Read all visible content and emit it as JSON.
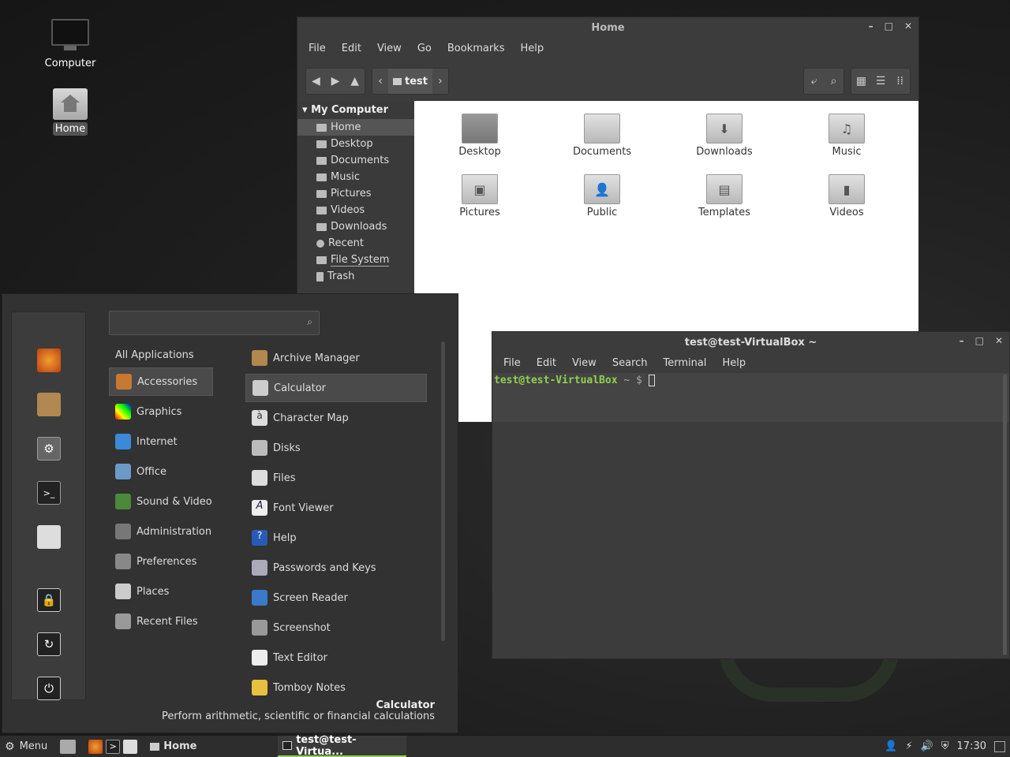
{
  "desktop": {
    "icons": [
      {
        "label": "Computer"
      },
      {
        "label": "Home"
      }
    ]
  },
  "file_manager": {
    "title": "Home",
    "menu": [
      "File",
      "Edit",
      "View",
      "Go",
      "Bookmarks",
      "Help"
    ],
    "path": "test",
    "sidebar_header": "My Computer",
    "sidebar_items": [
      "Home",
      "Desktop",
      "Documents",
      "Music",
      "Pictures",
      "Videos",
      "Downloads",
      "Recent",
      "File System",
      "Trash"
    ],
    "folders": [
      "Desktop",
      "Documents",
      "Downloads",
      "Music",
      "Pictures",
      "Public",
      "Templates",
      "Videos"
    ]
  },
  "start_menu": {
    "search_placeholder": "",
    "categories": [
      "All Applications",
      "Accessories",
      "Graphics",
      "Internet",
      "Office",
      "Sound & Video",
      "Administration",
      "Preferences",
      "Places",
      "Recent Files"
    ],
    "selected_category": "Accessories",
    "apps": [
      "Archive Manager",
      "Calculator",
      "Character Map",
      "Disks",
      "Files",
      "Font Viewer",
      "Help",
      "Passwords and Keys",
      "Screen Reader",
      "Screenshot",
      "Text Editor",
      "Tomboy Notes"
    ],
    "selected_app": "Calculator",
    "description_title": "Calculator",
    "description_text": "Perform arithmetic, scientific or financial calculations"
  },
  "terminal": {
    "title": "test@test-VirtualBox ~",
    "menu": [
      "File",
      "Edit",
      "View",
      "Search",
      "Terminal",
      "Help"
    ],
    "prompt": "test@test-VirtualBox",
    "prompt_suffix": "~ $"
  },
  "taskbar": {
    "menu_label": "Menu",
    "window_home": "Home",
    "window_terminal": "test@test-Virtua...",
    "clock": "17:30"
  },
  "colors": {
    "accent_green": "#8fd14f",
    "selection": "#555555"
  }
}
